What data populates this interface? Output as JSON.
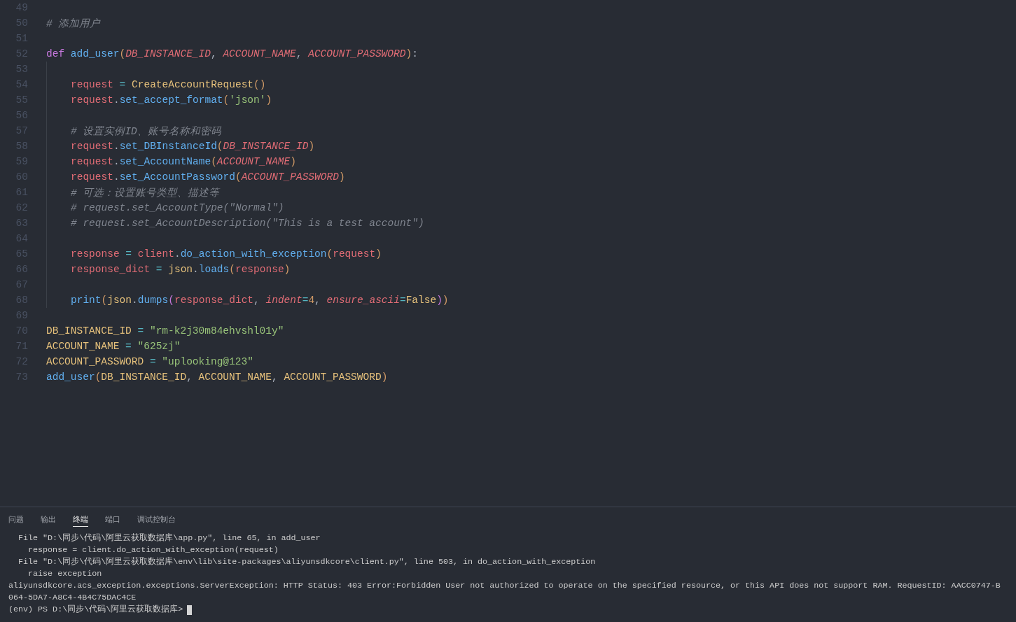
{
  "editor": {
    "lines": [
      {
        "number": "49"
      },
      {
        "number": "50",
        "tokens": [
          {
            "text": "# 添加用户",
            "kind": "comment"
          }
        ]
      },
      {
        "number": "51"
      },
      {
        "number": "52",
        "tokens": [
          {
            "text": "def ",
            "kind": "keyword"
          },
          {
            "text": "add_user",
            "kind": "function"
          },
          {
            "text": "(",
            "kind": "paren"
          },
          {
            "text": "DB_INSTANCE_ID",
            "kind": "param"
          },
          {
            "text": ", ",
            "kind": "punct"
          },
          {
            "text": "ACCOUNT_NAME",
            "kind": "param"
          },
          {
            "text": ", ",
            "kind": "punct"
          },
          {
            "text": "ACCOUNT_PASSWORD",
            "kind": "param"
          },
          {
            "text": ")",
            "kind": "paren"
          },
          {
            "text": ":",
            "kind": "punct"
          }
        ],
        "children": [
          {
            "number": "53"
          },
          {
            "number": "54",
            "tokens": [
              {
                "text": "request",
                "kind": "variable"
              },
              {
                "text": " = ",
                "kind": "operator"
              },
              {
                "text": "CreateAccountRequest",
                "kind": "class"
              },
              {
                "text": "()",
                "kind": "paren"
              }
            ]
          },
          {
            "number": "55",
            "tokens": [
              {
                "text": "request",
                "kind": "variable"
              },
              {
                "text": ".",
                "kind": "punct"
              },
              {
                "text": "set_accept_format",
                "kind": "function"
              },
              {
                "text": "(",
                "kind": "paren"
              },
              {
                "text": "'json'",
                "kind": "string"
              },
              {
                "text": ")",
                "kind": "paren"
              }
            ]
          },
          {
            "number": "56"
          },
          {
            "number": "57",
            "tokens": [
              {
                "text": "# 设置实例ID、账号名称和密码",
                "kind": "comment"
              }
            ]
          },
          {
            "number": "58",
            "tokens": [
              {
                "text": "request",
                "kind": "variable"
              },
              {
                "text": ".",
                "kind": "punct"
              },
              {
                "text": "set_DBInstanceId",
                "kind": "function"
              },
              {
                "text": "(",
                "kind": "paren"
              },
              {
                "text": "DB_INSTANCE_ID",
                "kind": "param"
              },
              {
                "text": ")",
                "kind": "paren"
              }
            ]
          },
          {
            "number": "59",
            "tokens": [
              {
                "text": "request",
                "kind": "variable"
              },
              {
                "text": ".",
                "kind": "punct"
              },
              {
                "text": "set_AccountName",
                "kind": "function"
              },
              {
                "text": "(",
                "kind": "paren"
              },
              {
                "text": "ACCOUNT_NAME",
                "kind": "param"
              },
              {
                "text": ")",
                "kind": "paren"
              }
            ]
          },
          {
            "number": "60",
            "tokens": [
              {
                "text": "request",
                "kind": "variable"
              },
              {
                "text": ".",
                "kind": "punct"
              },
              {
                "text": "set_AccountPassword",
                "kind": "function"
              },
              {
                "text": "(",
                "kind": "paren"
              },
              {
                "text": "ACCOUNT_PASSWORD",
                "kind": "param"
              },
              {
                "text": ")",
                "kind": "paren"
              }
            ]
          },
          {
            "number": "61",
            "tokens": [
              {
                "text": "# 可选：设置账号类型、描述等",
                "kind": "comment"
              }
            ]
          },
          {
            "number": "62",
            "tokens": [
              {
                "text": "# request.set_AccountType(\"Normal\")",
                "kind": "comment"
              }
            ]
          },
          {
            "number": "63",
            "tokens": [
              {
                "text": "# request.set_AccountDescription(\"This is a test account\")",
                "kind": "comment"
              }
            ]
          },
          {
            "number": "64"
          },
          {
            "number": "65",
            "tokens": [
              {
                "text": "response",
                "kind": "variable"
              },
              {
                "text": " = ",
                "kind": "operator"
              },
              {
                "text": "client",
                "kind": "variable"
              },
              {
                "text": ".",
                "kind": "punct"
              },
              {
                "text": "do_action_with_exception",
                "kind": "function"
              },
              {
                "text": "(",
                "kind": "paren"
              },
              {
                "text": "request",
                "kind": "variable"
              },
              {
                "text": ")",
                "kind": "paren"
              }
            ]
          },
          {
            "number": "66",
            "tokens": [
              {
                "text": "response_dict",
                "kind": "variable"
              },
              {
                "text": " = ",
                "kind": "operator"
              },
              {
                "text": "json",
                "kind": "class"
              },
              {
                "text": ".",
                "kind": "punct"
              },
              {
                "text": "loads",
                "kind": "function"
              },
              {
                "text": "(",
                "kind": "paren"
              },
              {
                "text": "response",
                "kind": "variable"
              },
              {
                "text": ")",
                "kind": "paren"
              }
            ]
          },
          {
            "number": "67"
          },
          {
            "number": "68",
            "tokens": [
              {
                "text": "print",
                "kind": "function"
              },
              {
                "text": "(",
                "kind": "paren"
              },
              {
                "text": "json",
                "kind": "class"
              },
              {
                "text": ".",
                "kind": "punct"
              },
              {
                "text": "dumps",
                "kind": "function"
              },
              {
                "text": "(",
                "kind": "bracket"
              },
              {
                "text": "response_dict",
                "kind": "variable"
              },
              {
                "text": ", ",
                "kind": "punct"
              },
              {
                "text": "indent",
                "kind": "param"
              },
              {
                "text": "=",
                "kind": "operator"
              },
              {
                "text": "4",
                "kind": "number"
              },
              {
                "text": ", ",
                "kind": "punct"
              },
              {
                "text": "ensure_ascii",
                "kind": "param"
              },
              {
                "text": "=",
                "kind": "operator"
              },
              {
                "text": "False",
                "kind": "class"
              },
              {
                "text": ")",
                "kind": "bracket"
              },
              {
                "text": ")",
                "kind": "paren"
              }
            ]
          }
        ]
      },
      {
        "number": "69"
      },
      {
        "number": "70",
        "tokens": [
          {
            "text": "DB_INSTANCE_ID",
            "kind": "class"
          },
          {
            "text": " = ",
            "kind": "operator"
          },
          {
            "text": "\"rm-k2j30m84ehvshl01y\"",
            "kind": "string"
          }
        ]
      },
      {
        "number": "71",
        "tokens": [
          {
            "text": "ACCOUNT_NAME",
            "kind": "class"
          },
          {
            "text": " = ",
            "kind": "operator"
          },
          {
            "text": "\"625zj\"",
            "kind": "string"
          }
        ]
      },
      {
        "number": "72",
        "tokens": [
          {
            "text": "ACCOUNT_PASSWORD",
            "kind": "class"
          },
          {
            "text": " = ",
            "kind": "operator"
          },
          {
            "text": "\"uplooking@123\"",
            "kind": "string"
          }
        ]
      },
      {
        "number": "73",
        "tokens": [
          {
            "text": "add_user",
            "kind": "function"
          },
          {
            "text": "(",
            "kind": "paren"
          },
          {
            "text": "DB_INSTANCE_ID",
            "kind": "class"
          },
          {
            "text": ", ",
            "kind": "punct"
          },
          {
            "text": "ACCOUNT_NAME",
            "kind": "class"
          },
          {
            "text": ", ",
            "kind": "punct"
          },
          {
            "text": "ACCOUNT_PASSWORD",
            "kind": "class"
          },
          {
            "text": ")",
            "kind": "paren"
          }
        ]
      }
    ]
  },
  "panel": {
    "tabs": [
      {
        "label": "问题",
        "selected": false
      },
      {
        "label": "输出",
        "selected": false
      },
      {
        "label": "终端",
        "selected": true
      },
      {
        "label": "端口",
        "selected": false
      },
      {
        "label": "调试控制台",
        "selected": false
      }
    ],
    "terminal": {
      "lines": [
        "  File \"D:\\同步\\代码\\阿里云获取数据库\\app.py\", line 65, in add_user",
        "    response = client.do_action_with_exception(request)",
        "  File \"D:\\同步\\代码\\阿里云获取数据库\\env\\lib\\site-packages\\aliyunsdkcore\\client.py\", line 503, in do_action_with_exception",
        "    raise exception",
        "aliyunsdkcore.acs_exception.exceptions.ServerException: HTTP Status: 403 Error:Forbidden User not authorized to operate on the specified resource, or this API does not support RAM. RequestID: AACC0747-B",
        "064-5DA7-A8C4-4B4C75DAC4CE"
      ],
      "prompt": "(env) PS D:\\同步\\代码\\阿里云获取数据库>"
    }
  }
}
